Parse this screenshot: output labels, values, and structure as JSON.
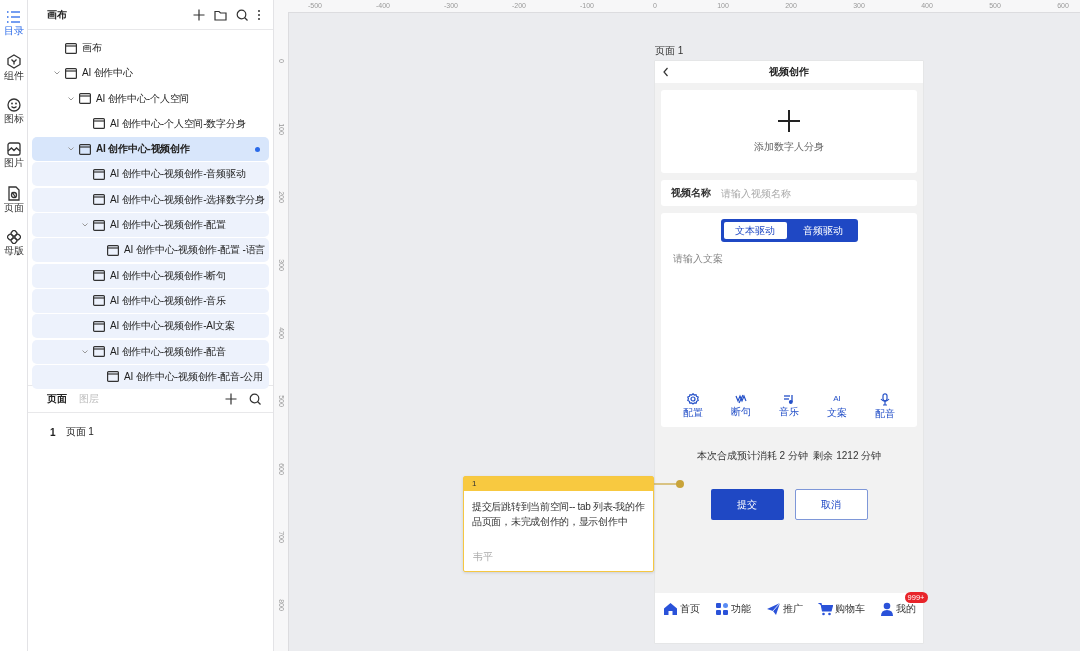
{
  "rail": [
    {
      "label": "目录",
      "selected": true
    },
    {
      "label": "组件",
      "selected": false
    },
    {
      "label": "图标",
      "selected": false
    },
    {
      "label": "图片",
      "selected": false
    },
    {
      "label": "页面",
      "selected": false
    },
    {
      "label": "母版",
      "selected": false
    }
  ],
  "panel": {
    "title": "画布"
  },
  "tree": [
    {
      "label": "画布",
      "selected": false
    },
    {
      "label": "AI 创作中心",
      "selected": false,
      "expanded": true,
      "children": [
        {
          "label": "AI 创作中心-个人空间",
          "selected": false,
          "expanded": true,
          "children": [
            {
              "label": "AI 创作中心-个人空间-数字分身",
              "selected": false
            }
          ]
        },
        {
          "label": "AI 创作中心-视频创作",
          "selected": true,
          "expanded": true,
          "children": [
            {
              "label": "AI 创作中心-视频创作-音频驱动",
              "selected": false
            },
            {
              "label": "AI 创作中心-视频创作-选择数字分身",
              "selected": false
            },
            {
              "label": "AI 创作中心-视频创作-配置",
              "selected": false,
              "expanded": true,
              "children": [
                {
                  "label": "AI 创作中心-视频创作-配置 -语言",
                  "selected": false
                }
              ]
            },
            {
              "label": "AI 创作中心-视频创作-断句",
              "selected": false
            },
            {
              "label": "AI 创作中心-视频创作-音乐",
              "selected": false
            },
            {
              "label": "AI 创作中心-视频创作-AI文案",
              "selected": false
            },
            {
              "label": "AI 创作中心-视频创作-配音",
              "selected": false,
              "expanded": true,
              "children": [
                {
                  "label": "AI 创作中心-视频创作-配音-公用",
                  "selected": false
                }
              ]
            }
          ]
        }
      ]
    }
  ],
  "bottom_tabs": [
    {
      "label": "页面",
      "selected": true
    },
    {
      "label": "图层",
      "selected": false
    }
  ],
  "pages": [
    {
      "number": "1",
      "label": "页面 1"
    }
  ],
  "ruler": {
    "horizontal": [
      "-500",
      "-400",
      "-300",
      "-200",
      "-100",
      "0",
      "100",
      "200",
      "300",
      "400",
      "500",
      "600"
    ],
    "vertical": [
      "0",
      "100",
      "200",
      "300",
      "400",
      "500",
      "600",
      "700",
      "800"
    ]
  },
  "artboard": {
    "label": "页面 1",
    "title": "视频创作",
    "add_label": "添加数字人分身",
    "name_field": {
      "label": "视频名称",
      "placeholder": "请输入视频名称"
    },
    "segments": [
      {
        "label": "文本驱动",
        "selected": true
      },
      {
        "label": "音频驱动",
        "selected": false
      }
    ],
    "script_placeholder": "请输入文案",
    "tools": [
      {
        "kind": "gear",
        "label": "配置"
      },
      {
        "kind": "waves",
        "label": "断句"
      },
      {
        "kind": "music",
        "label": "音乐"
      },
      {
        "kind": "glyph",
        "glyph": "AI",
        "label": "文案"
      },
      {
        "kind": "mic",
        "label": "配音"
      }
    ],
    "cost": "本次合成预计消耗 2 分钟  剩余 1212 分钟",
    "buttons": [
      {
        "label": "提交",
        "kind": "primary"
      },
      {
        "label": "取消",
        "kind": "secondary"
      }
    ],
    "tabbar": [
      {
        "kind": "home",
        "label": "首页"
      },
      {
        "kind": "grid",
        "label": "功能"
      },
      {
        "kind": "plane",
        "label": "推广"
      },
      {
        "kind": "cart",
        "label": "购物车"
      },
      {
        "kind": "user",
        "label": "我的",
        "badge": "999+"
      }
    ]
  },
  "note": {
    "number": "1",
    "text": "提交后跳转到当前空间-- tab 列表-我的作品页面，未完成创作的，显示创作中",
    "author": "韦平"
  }
}
